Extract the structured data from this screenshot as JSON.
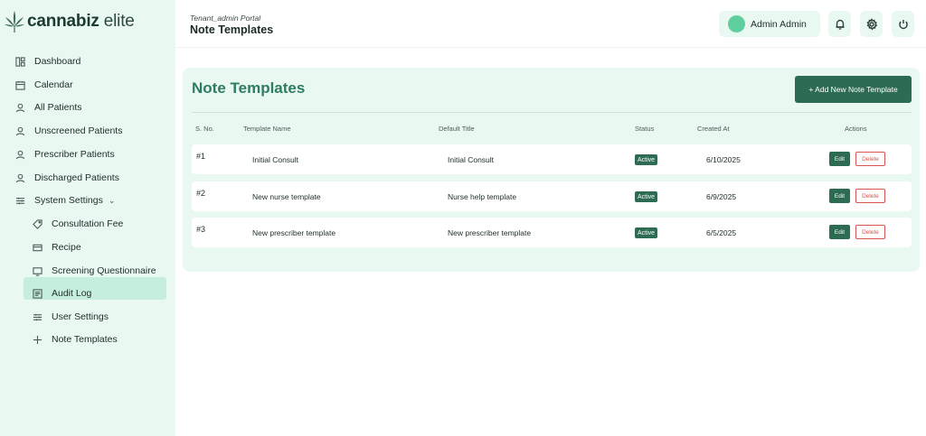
{
  "brand": {
    "name_bold": "cannabiz",
    "name_light": "elite"
  },
  "sidebar": {
    "items": [
      {
        "label": "Dashboard",
        "icon": "dashboard-icon"
      },
      {
        "label": "Calendar",
        "icon": "calendar-icon"
      },
      {
        "label": "All Patients",
        "icon": "user-icon"
      },
      {
        "label": "Unscreened Patients",
        "icon": "user-icon"
      },
      {
        "label": "Prescriber Patients",
        "icon": "user-icon"
      },
      {
        "label": "Discharged Patients",
        "icon": "user-icon"
      },
      {
        "label": "System Settings",
        "icon": "sliders-icon",
        "expanded": true
      }
    ],
    "sub_items": [
      {
        "label": "Consultation Fee",
        "icon": "tag-icon"
      },
      {
        "label": "Recipe",
        "icon": "card-icon"
      },
      {
        "label": "Screening Questionnaire",
        "icon": "monitor-icon"
      },
      {
        "label": "Audit Log",
        "icon": "log-icon"
      },
      {
        "label": "User Settings",
        "icon": "sliders-icon"
      },
      {
        "label": "Note Templates",
        "icon": "plus-icon",
        "active": true
      }
    ]
  },
  "header": {
    "portal": "Tenant_admin Portal",
    "title": "Note Templates",
    "user_name": "Admin Admin"
  },
  "main": {
    "title": "Note Templates",
    "add_button": "+ Add New Note Template",
    "columns": [
      "S. No.",
      "Template Name",
      "Default Title",
      "Status",
      "Created At",
      "Actions"
    ],
    "rows": [
      {
        "sno": "#1",
        "name": "Initial Consult",
        "title": "Initial Consult",
        "status": "Active",
        "created": "6/10/2025"
      },
      {
        "sno": "#2",
        "name": "New nurse template",
        "title": "Nurse help template",
        "status": "Active",
        "created": "6/9/2025"
      },
      {
        "sno": "#3",
        "name": "New prescriber template",
        "title": "New prescriber template",
        "status": "Active",
        "created": "6/5/2025"
      }
    ],
    "edit_label": "Edit",
    "delete_label": "Delete"
  },
  "colors": {
    "accent": "#2d6b53",
    "sidebar_bg": "#e9f8f1",
    "active_bg": "#c6eedd",
    "title": "#2e7d62",
    "danger": "#d9534f"
  }
}
